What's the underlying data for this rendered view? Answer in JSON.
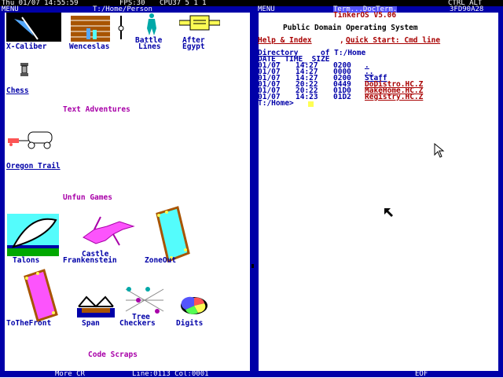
{
  "topbar": {
    "datetime": "Thu 01/07 14:55:59",
    "fps": "FPS:30",
    "cpu": "CPU37 5 1 1",
    "keys": "CTRL ALT"
  },
  "left_window": {
    "menu": "MENU",
    "path": "T:/Home/Person",
    "status_more": "More CR",
    "status_line": "Line:0113 Col:0001",
    "items_row1": [
      "X-Caliber",
      "Wenceslas",
      "Battle",
      "Lines",
      "After",
      "Egypt"
    ],
    "chess": "Chess",
    "text_adv": "Text Adventures",
    "oregon": "Oregon Trail",
    "unfun": "Unfun Games",
    "castle1": "Castle",
    "castle2": "Frankenstein",
    "talons": "Talons",
    "zoneout": "ZoneOut",
    "tothefront": "ToTheFront",
    "span": "Span",
    "tree1": "Tree",
    "tree2": "Checkers",
    "digits": "Digits",
    "code": "Code Scraps"
  },
  "right_window": {
    "menu": "MENU",
    "title": "Term...DocTerm.",
    "addr": "3FD90A28",
    "os_name": "TinkerOS V5.06",
    "subtitle": "Public Domain Operating System",
    "help": "Help & Index",
    "quick": "Quick Start: Cmd line",
    "dir_prefix": "Directory",
    "dir_suffix": "of T:/Home",
    "header": "DATE_ TIME_ SIZE",
    "rows": [
      {
        "date": "01/07",
        "time": "14:27",
        "size": "0200",
        "name": "."
      },
      {
        "date": "01/07",
        "time": "14:27",
        "size": "0000",
        "name": ".."
      },
      {
        "date": "01/07",
        "time": "14:27",
        "size": "0200",
        "name": "Staff"
      },
      {
        "date": "01/07",
        "time": "20:22",
        "size": "0449",
        "name": "DoDistro.HC.Z"
      },
      {
        "date": "01/07",
        "time": "20:22",
        "size": "01D0",
        "name": "MakeHome.HC.Z"
      },
      {
        "date": "01/07",
        "time": "14:23",
        "size": "01D2",
        "name": "Registry.HC.Z"
      }
    ],
    "prompt": "T:/Home>",
    "status": "EOF"
  },
  "colors": {
    "border": "#0000a8",
    "link": "#0000a8",
    "heading": "#a800a8",
    "file": "#a80000",
    "cursor": "#ffff54"
  }
}
